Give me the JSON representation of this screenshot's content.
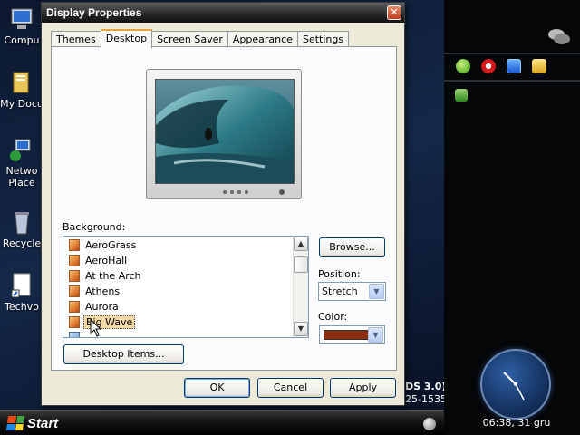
{
  "desktop": {
    "icons": [
      {
        "label": "Compu",
        "icon": "computer-icon"
      },
      {
        "label": "My Docu",
        "icon": "documents-folder-icon"
      },
      {
        "label": "Netwo",
        "label2": "Place",
        "icon": "network-places-icon"
      },
      {
        "label": "Recycle",
        "icon": "recycle-bin-icon"
      },
      {
        "label": "Techvo",
        "icon": "shortcut-file-icon"
      }
    ],
    "background_text": {
      "line1": "DS 3.0)",
      "line2": "25-1535"
    }
  },
  "taskbar": {
    "start_label": "Start"
  },
  "side_panel": {
    "clock_text": "06:38, 31 gru"
  },
  "dialog": {
    "title": "Display Properties",
    "close_glyph": "✕",
    "tabs": [
      {
        "label": "Themes",
        "active": false
      },
      {
        "label": "Desktop",
        "active": true
      },
      {
        "label": "Screen Saver",
        "active": false
      },
      {
        "label": "Appearance",
        "active": false
      },
      {
        "label": "Settings",
        "active": false
      }
    ],
    "background_label": "Background:",
    "background_items": [
      "AeroGrass",
      "AeroHall",
      "At the Arch",
      "Athens",
      "Aurora",
      "Big Wave"
    ],
    "selected_item": "Big Wave",
    "browse_label": "Browse...",
    "position_label": "Position:",
    "position_value": "Stretch",
    "color_label": "Color:",
    "color_value": "#8b2e10",
    "desktop_items_label": "Desktop Items...",
    "ok_label": "OK",
    "cancel_label": "Cancel",
    "apply_label": "Apply"
  }
}
